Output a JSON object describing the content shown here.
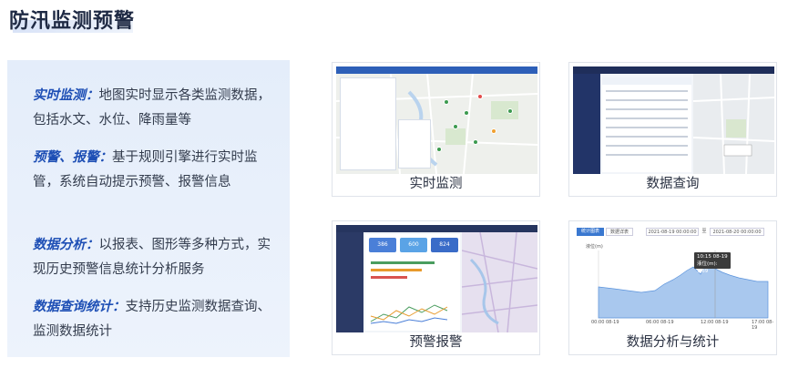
{
  "title": "防汛监测预警",
  "features": [
    {
      "keyword": "实时监测：",
      "text": "地图实时显示各类监测数据，包括水文、水位、降雨量等"
    },
    {
      "keyword": "预警、报警：",
      "text": "基于规则引擎进行实时监管，系统自动提示预警、报警信息"
    },
    {
      "keyword": "数据分析：",
      "text": "以报表、图形等多种方式，实现历史预警信息统计分析服务"
    },
    {
      "keyword": "数据查询统计：",
      "text": "支持历史监测数据查询、监测数据统计"
    }
  ],
  "cards": [
    {
      "caption": "实时监测"
    },
    {
      "caption": "数据查询"
    },
    {
      "caption": "预警报警"
    },
    {
      "caption": "数据分析与统计"
    }
  ],
  "shot3": {
    "stats": [
      "386",
      "600",
      "824"
    ]
  },
  "shot4": {
    "tabs": [
      "统计图表",
      "数据详表"
    ],
    "date_from": "2021-08-19 00:00:00",
    "date_sep": "至",
    "date_to": "2021-08-20 00:00:00",
    "y_unit": "液位(m)",
    "tooltip_time": "10:15 08-19",
    "tooltip_value": "液位(m): 1.89",
    "x_ticks": [
      "00:00\n08-19",
      "06:00\n08-19",
      "12:00\n08-19",
      "17:00\n08-19"
    ]
  },
  "colors": {
    "accent": "#1e4fb5",
    "panel": "#e4edfa"
  }
}
